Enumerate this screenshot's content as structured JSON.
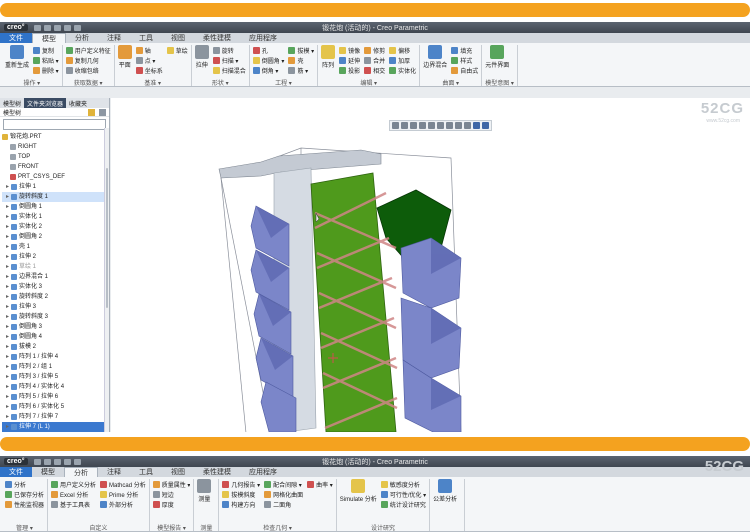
{
  "window1": {
    "title": "锻花炮 (活动的) - Creo Parametric",
    "logo": "creo°",
    "tabs": [
      "文件",
      "模型",
      "分析",
      "注释",
      "工具",
      "视图",
      "柔性建模",
      "应用程序"
    ],
    "active_tab": "模型",
    "groups": [
      {
        "label": "操作 ▾",
        "big": "重新生成",
        "items": [
          "复制",
          "粘贴 ▾",
          "删除 ▾"
        ]
      },
      {
        "label": "获取数据 ▾",
        "items": [
          "用户定义特征",
          "复制几何",
          "收缩包络"
        ]
      },
      {
        "label": "基准 ▾",
        "big": "平面",
        "items": [
          "轴",
          "点 ▾",
          "坐标系",
          "草绘"
        ]
      },
      {
        "label": "形状 ▾",
        "big": "拉伸",
        "items": [
          "旋转",
          "扫描 ▾",
          "扫描混合"
        ]
      },
      {
        "label": "工程 ▾",
        "items": [
          "孔",
          "倒圆角 ▾",
          "倒角 ▾",
          "拔模 ▾",
          "壳",
          "筋 ▾"
        ]
      },
      {
        "label": "编辑 ▾",
        "big": "阵列",
        "items": [
          "镜像",
          "延伸",
          "投影",
          "修剪",
          "合并",
          "相交",
          "偏移",
          "加厚",
          "实体化"
        ]
      },
      {
        "label": "曲面 ▾",
        "big": "边界混合",
        "items": [
          "填充",
          "样式",
          "自由式"
        ]
      },
      {
        "label": "模型意图 ▾",
        "big": "元件界面",
        "items": []
      }
    ],
    "panel_tabs": [
      "模型树",
      "文件夹浏览器",
      "收藏夹"
    ],
    "panel_tool_label": "模型树",
    "tree": [
      {
        "label": "锻花炮.PRT",
        "kind": "part"
      },
      {
        "label": "RIGHT",
        "kind": "plane"
      },
      {
        "label": "TOP",
        "kind": "plane"
      },
      {
        "label": "FRONT",
        "kind": "plane"
      },
      {
        "label": "PRT_CSYS_DEF",
        "kind": "csys"
      },
      {
        "label": "拉伸 1",
        "kind": "feat"
      },
      {
        "label": "旋转斜度 1",
        "kind": "feat",
        "state": "sel"
      },
      {
        "label": "倒圆角 1",
        "kind": "feat"
      },
      {
        "label": "实体化 1",
        "kind": "feat"
      },
      {
        "label": "实体化 2",
        "kind": "feat"
      },
      {
        "label": "倒圆角 2",
        "kind": "feat"
      },
      {
        "label": "壳 1",
        "kind": "feat"
      },
      {
        "label": "拉伸 2",
        "kind": "feat"
      },
      {
        "label": "草绘 1",
        "kind": "feat",
        "state": "dim"
      },
      {
        "label": "边界混合 1",
        "kind": "feat"
      },
      {
        "label": "实体化 3",
        "kind": "feat"
      },
      {
        "label": "旋转斜度 2",
        "kind": "feat"
      },
      {
        "label": "拉伸 3",
        "kind": "feat"
      },
      {
        "label": "旋转斜度 3",
        "kind": "feat"
      },
      {
        "label": "倒圆角 3",
        "kind": "feat"
      },
      {
        "label": "倒圆角 4",
        "kind": "feat"
      },
      {
        "label": "拔模 2",
        "kind": "feat"
      },
      {
        "label": "阵列 1 / 拉伸 4",
        "kind": "feat"
      },
      {
        "label": "阵列 2 / 组 1",
        "kind": "feat"
      },
      {
        "label": "阵列 3 / 拉伸 5",
        "kind": "feat"
      },
      {
        "label": "阵列 4 / 实体化 4",
        "kind": "feat"
      },
      {
        "label": "阵列 5 / 拉伸 6",
        "kind": "feat"
      },
      {
        "label": "阵列 6 / 实体化 5",
        "kind": "feat"
      },
      {
        "label": "阵列 7 / 拉伸 7",
        "kind": "feat"
      },
      {
        "label": "拉伸 7 (L 1)",
        "kind": "feat",
        "state": "active"
      }
    ]
  },
  "window2": {
    "title": "锻花炮 (活动的) - Creo Parametric",
    "logo": "creo°",
    "tabs": [
      "文件",
      "模型",
      "分析",
      "注释",
      "工具",
      "视图",
      "柔性建模",
      "应用程序"
    ],
    "active_tab": "分析",
    "groups": [
      {
        "label": "管理 ▾",
        "items": [
          "分析",
          "已保存分析",
          "性能监视器"
        ]
      },
      {
        "label": "自定义",
        "items": [
          "用户定义分析",
          "Excel 分析",
          "基于工具表",
          "Mathcad 分析",
          "Prime 分析",
          "外部分析"
        ]
      },
      {
        "label": "模型报告 ▾",
        "items": [
          "质量属性 ▾",
          "短边",
          "厚度"
        ]
      },
      {
        "label": "测量",
        "big": "测量",
        "items": []
      },
      {
        "label": "检查几何 ▾",
        "items": [
          "几何报告 ▾",
          "拔模斜度",
          "构建方向",
          "配合间隙 ▾",
          "网格化曲面",
          "二面角",
          "曲率 ▾"
        ]
      },
      {
        "label": "设计研究",
        "big": "Simulate 分析",
        "items": [
          "敏感度分析",
          "可行性/优化 ▾",
          "统计设计研究"
        ]
      },
      {
        "label": "",
        "big": "公差分析",
        "items": []
      }
    ]
  },
  "watermark": {
    "brand": "52CG",
    "url": "www.52cg.com"
  },
  "colors": {
    "accent_orange": "#f4a21f",
    "file_tab": "#2f73c9",
    "model_green": "#4a8a1a",
    "model_blue": "#7a86c8"
  }
}
